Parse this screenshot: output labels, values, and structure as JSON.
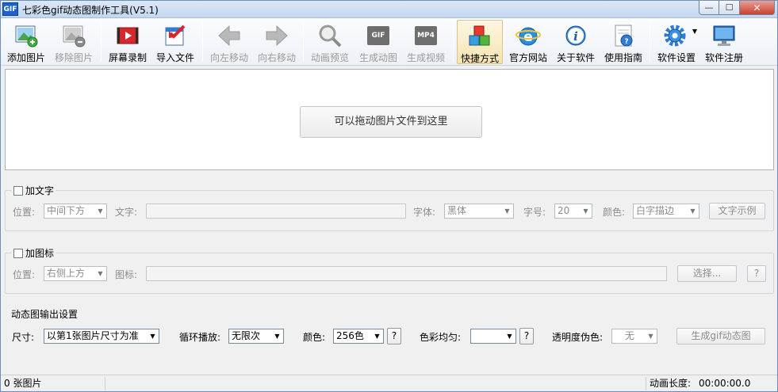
{
  "window": {
    "icon_text": "GIF",
    "title": "七彩色gif动态图制作工具(V5.1)",
    "min_glyph": "—",
    "max_glyph": "☐",
    "close_glyph": "✕"
  },
  "toolbar": {
    "add_image": "添加图片",
    "remove_image": "移除图片",
    "screen_record": "屏幕录制",
    "import_file": "导入文件",
    "move_left": "向左移动",
    "move_right": "向右移动",
    "preview": "动画预览",
    "make_gif": "生成动图",
    "make_video": "生成视频",
    "shortcut": "快捷方式",
    "website": "官方网站",
    "about": "关于软件",
    "guide": "使用指南",
    "settings": "软件设置",
    "register": "软件注册",
    "gif_badge": "GIF",
    "mp4_badge": "MP4"
  },
  "drop": {
    "hint": "可以拖动图片文件到这里"
  },
  "text_group": {
    "title": "加文字",
    "position_label": "位置:",
    "position_value": "中间下方",
    "text_label": "文字:",
    "font_label": "字体:",
    "font_value": "黑体",
    "size_label": "字号:",
    "size_value": "20",
    "color_label": "颜色:",
    "color_value": "白字描边",
    "sample_button": "文字示例"
  },
  "icon_group": {
    "title": "加图标",
    "position_label": "位置:",
    "position_value": "右侧上方",
    "icon_label": "图标:",
    "select_button": "选择...",
    "help_button": "?"
  },
  "output_group": {
    "title": "动态图输出设置",
    "size_label": "尺寸:",
    "size_value": "以第1张图片尺寸为准",
    "loop_label": "循环播放:",
    "loop_value": "无限次",
    "color_label": "颜色:",
    "color_value": "256色",
    "color_help": "?",
    "balance_label": "色彩均匀:",
    "balance_value": "",
    "balance_help": "?",
    "alpha_label": "透明度伪色:",
    "alpha_value": "无",
    "generate_button": "生成gif动态图"
  },
  "status": {
    "count": "0 张图片",
    "duration_label": "动画长度:",
    "duration_value": "00:00:00.0"
  }
}
